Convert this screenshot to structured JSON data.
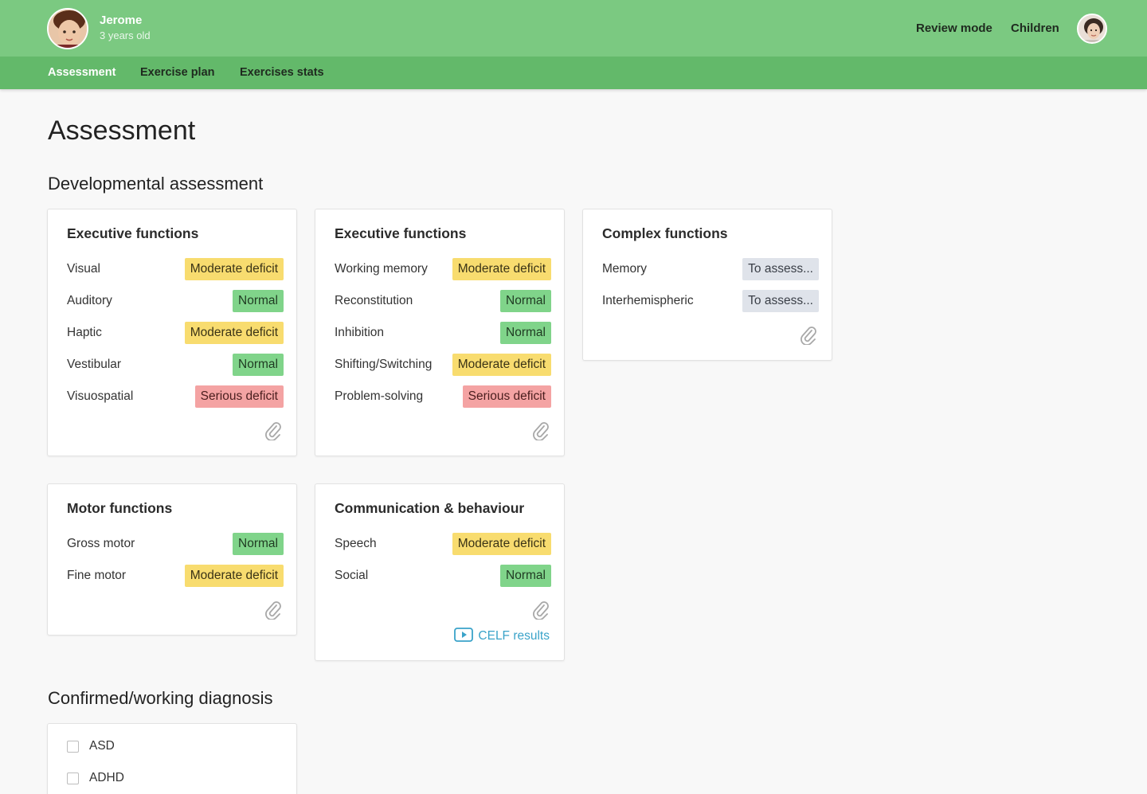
{
  "header": {
    "child_name": "Jerome",
    "child_age": "3 years old",
    "review_mode": "Review mode",
    "children": "Children"
  },
  "tabs": [
    "Assessment",
    "Exercise plan",
    "Exercises stats"
  ],
  "page_title": "Assessment",
  "developmental_title": "Developmental assessment",
  "cards": [
    {
      "title": "Executive functions",
      "rows": [
        {
          "label": "Visual",
          "status": "Moderate deficit"
        },
        {
          "label": "Auditory",
          "status": "Normal"
        },
        {
          "label": "Haptic",
          "status": "Moderate deficit"
        },
        {
          "label": "Vestibular",
          "status": "Normal"
        },
        {
          "label": "Visuospatial",
          "status": "Serious deficit"
        }
      ]
    },
    {
      "title": "Executive functions",
      "rows": [
        {
          "label": "Working memory",
          "status": "Moderate deficit"
        },
        {
          "label": "Reconstitution",
          "status": "Normal"
        },
        {
          "label": "Inhibition",
          "status": "Normal"
        },
        {
          "label": "Shifting/Switching",
          "status": "Moderate deficit"
        },
        {
          "label": "Problem-solving",
          "status": "Serious deficit"
        }
      ]
    },
    {
      "title": "Complex functions",
      "rows": [
        {
          "label": "Memory",
          "status": "To assess..."
        },
        {
          "label": "Interhemispheric",
          "status": "To assess..."
        }
      ]
    },
    {
      "title": "Motor functions",
      "rows": [
        {
          "label": "Gross motor",
          "status": "Normal"
        },
        {
          "label": "Fine motor",
          "status": "Moderate deficit"
        }
      ]
    },
    {
      "title": "Communication & behaviour",
      "rows": [
        {
          "label": "Speech",
          "status": "Moderate deficit"
        },
        {
          "label": "Social",
          "status": "Normal"
        }
      ],
      "link": "CELF results"
    }
  ],
  "diagnosis_title": "Confirmed/working diagnosis",
  "diagnoses": [
    {
      "label": "ASD",
      "checked": false
    },
    {
      "label": "ADHD",
      "checked": false
    }
  ],
  "colors": {
    "header": "#7bc981",
    "subnav": "#63b96a",
    "moderate": "#f8dc6f",
    "normal": "#80d48a",
    "serious": "#f4a3a3",
    "assess": "#dfe3ea",
    "link": "#3aa3c9"
  },
  "icons": [
    "child-avatar",
    "user-avatar",
    "paperclip-icon",
    "video-icon",
    "checkbox"
  ]
}
